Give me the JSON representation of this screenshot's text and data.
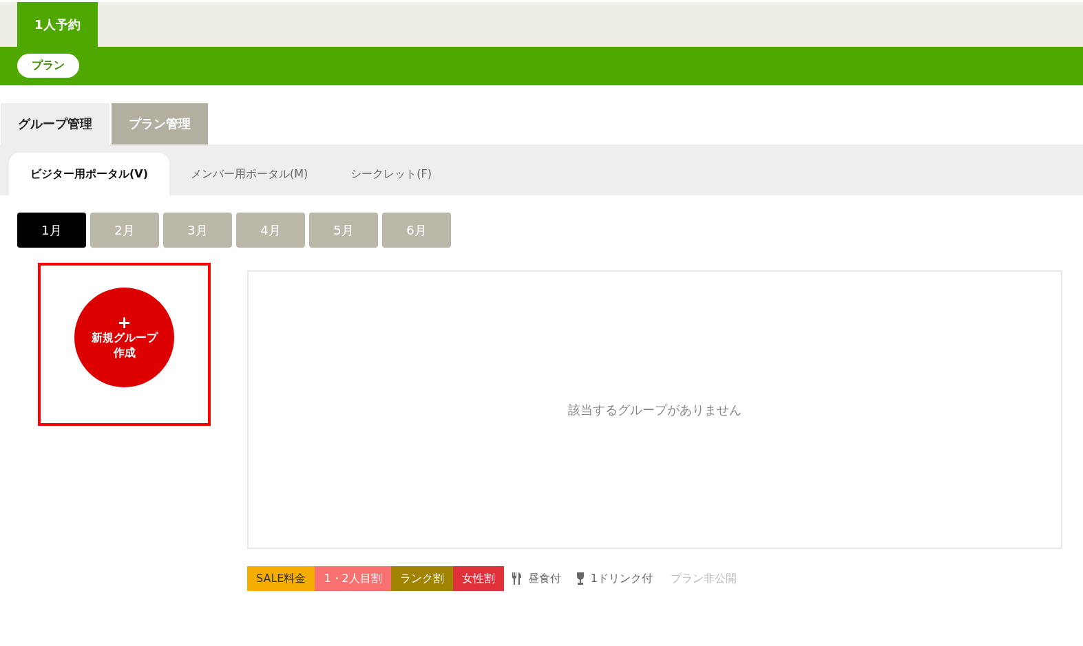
{
  "top_tabs": [
    {
      "label": "1人予約",
      "selected": true
    }
  ],
  "plan_pill": "プラン",
  "main_tabs": [
    {
      "label": "グループ管理",
      "selected": true
    },
    {
      "label": "プラン管理",
      "selected": false
    }
  ],
  "portal_tabs": [
    {
      "label": "ビジター用ポータル(V)",
      "selected": true
    },
    {
      "label": "メンバー用ポータル(M)",
      "selected": false
    },
    {
      "label": "シークレット(F)",
      "selected": false
    }
  ],
  "months": [
    {
      "label": "1月",
      "selected": true
    },
    {
      "label": "2月",
      "selected": false
    },
    {
      "label": "3月",
      "selected": false
    },
    {
      "label": "4月",
      "selected": false
    },
    {
      "label": "5月",
      "selected": false
    },
    {
      "label": "6月",
      "selected": false
    }
  ],
  "new_group": {
    "icon": "+",
    "label": "新規グループ作成"
  },
  "empty_message": "該当するグループがありません",
  "legend": [
    {
      "kind": "badge",
      "label": "SALE料金",
      "color": "#f5ae00"
    },
    {
      "kind": "badge",
      "label": "1・2人目割",
      "color": "#f87171"
    },
    {
      "kind": "badge",
      "label": "ランク割",
      "color": "#a08300"
    },
    {
      "kind": "badge",
      "label": "女性割",
      "color": "#e0313a"
    },
    {
      "kind": "meal",
      "label": "昼食付"
    },
    {
      "kind": "drink",
      "label": "1ドリンク付"
    },
    {
      "kind": "muted",
      "label": "プラン非公開"
    }
  ]
}
